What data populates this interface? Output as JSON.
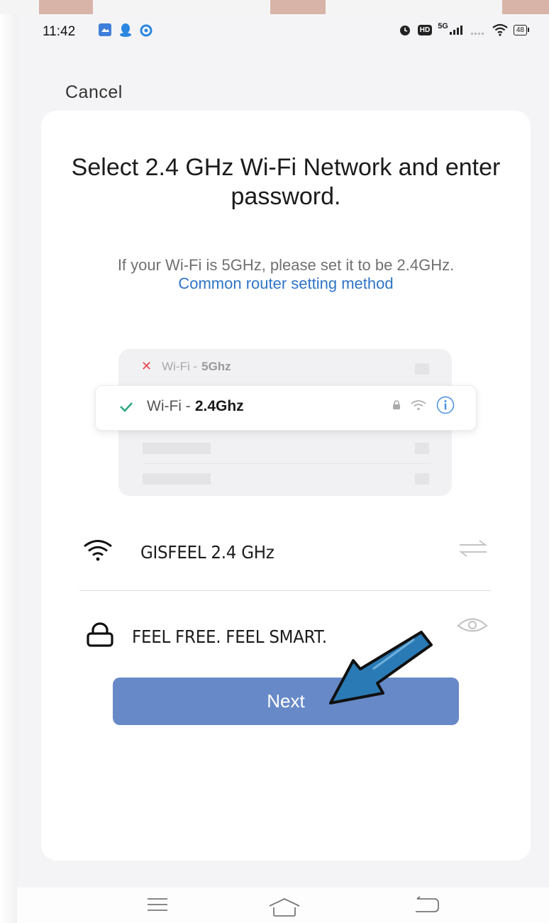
{
  "status_bar": {
    "time": "11:42",
    "network_label": "5G",
    "hd_label": "HD",
    "battery": "48"
  },
  "header": {
    "cancel_label": "Cancel"
  },
  "card": {
    "title": "Select 2.4 GHz Wi-Fi Network and enter password.",
    "subtitle_text": "If your Wi-Fi is 5GHz, please set it to be 2.4GHz.",
    "subtitle_link": "Common router setting method"
  },
  "illustration": {
    "row_5ghz_prefix": "Wi-Fi -",
    "row_5ghz_band": "5Ghz",
    "row_24ghz_prefix": "Wi-Fi -",
    "row_24ghz_band": "2.4Ghz"
  },
  "form": {
    "ssid_value": "GISFEEL 2.4 GHz",
    "password_value": "FEEL FREE. FEEL SMART."
  },
  "next_label": "Next",
  "colors": {
    "accent_button": "#6789c7",
    "link": "#2f74c7",
    "check_green": "#2daa7d",
    "error_red": "#e8434a",
    "arrow_blue": "#2a7ab5"
  }
}
